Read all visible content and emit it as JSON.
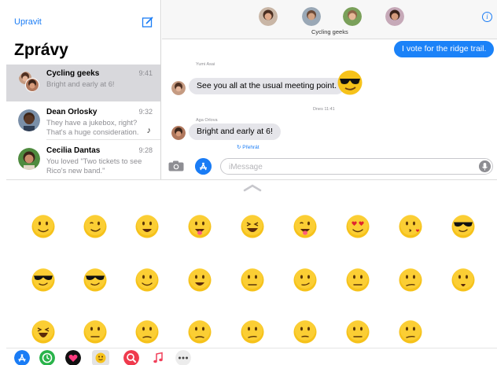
{
  "sidebar": {
    "edit_label": "Upravit",
    "title": "Zprávy",
    "conversations": [
      {
        "name": "Cycling geeks",
        "time": "9:41",
        "preview": "Bright and early at 6!",
        "selected": true
      },
      {
        "name": "Dean Orlosky",
        "time": "9:32",
        "preview": "They have a jukebox, right? That's a huge consideration.",
        "selected": false
      },
      {
        "name": "Cecilia Dantas",
        "time": "9:28",
        "preview": "You loved \"Two tickets to see Rico's new band.\"",
        "selected": false
      }
    ]
  },
  "header": {
    "group_name": "Cycling geeks",
    "info_icon": "info-icon"
  },
  "chat": {
    "outgoing_1": "I vote for the ridge trail.",
    "sender_1": "Yumi Asai",
    "incoming_1": "See you all at the usual meeting point.",
    "timestamp": "Dnes 11:41",
    "sender_2": "Aga Orlova",
    "incoming_2": "Bright and early at 6!",
    "replay_label": "↻ Přehrát",
    "input_placeholder": "iMessage"
  },
  "drawer": {
    "sticker_names": [
      "smile",
      "wink",
      "grin",
      "tongue",
      "laugh",
      "tongue-wink",
      "heart-eyes",
      "kiss",
      "sunglasses",
      "sunglasses",
      "cool",
      "smile",
      "grin",
      "neutral",
      "smirk",
      "neutral",
      "confused",
      "surprised",
      "shout",
      "neutral",
      "unamused",
      "unamused",
      "confused",
      "thinking",
      "neutral",
      "confused"
    ],
    "app_icons": [
      "app-store-icon",
      "activity-icon",
      "heart-app-icon",
      "stickers-icon",
      "search-images-icon",
      "music-icon",
      "more-icon"
    ]
  },
  "colors": {
    "accent": "#1a7cf5",
    "outgoing_bubble": "#1b82f8",
    "incoming_bubble": "#e5e5ea",
    "selected_row": "#d8d8dc"
  }
}
